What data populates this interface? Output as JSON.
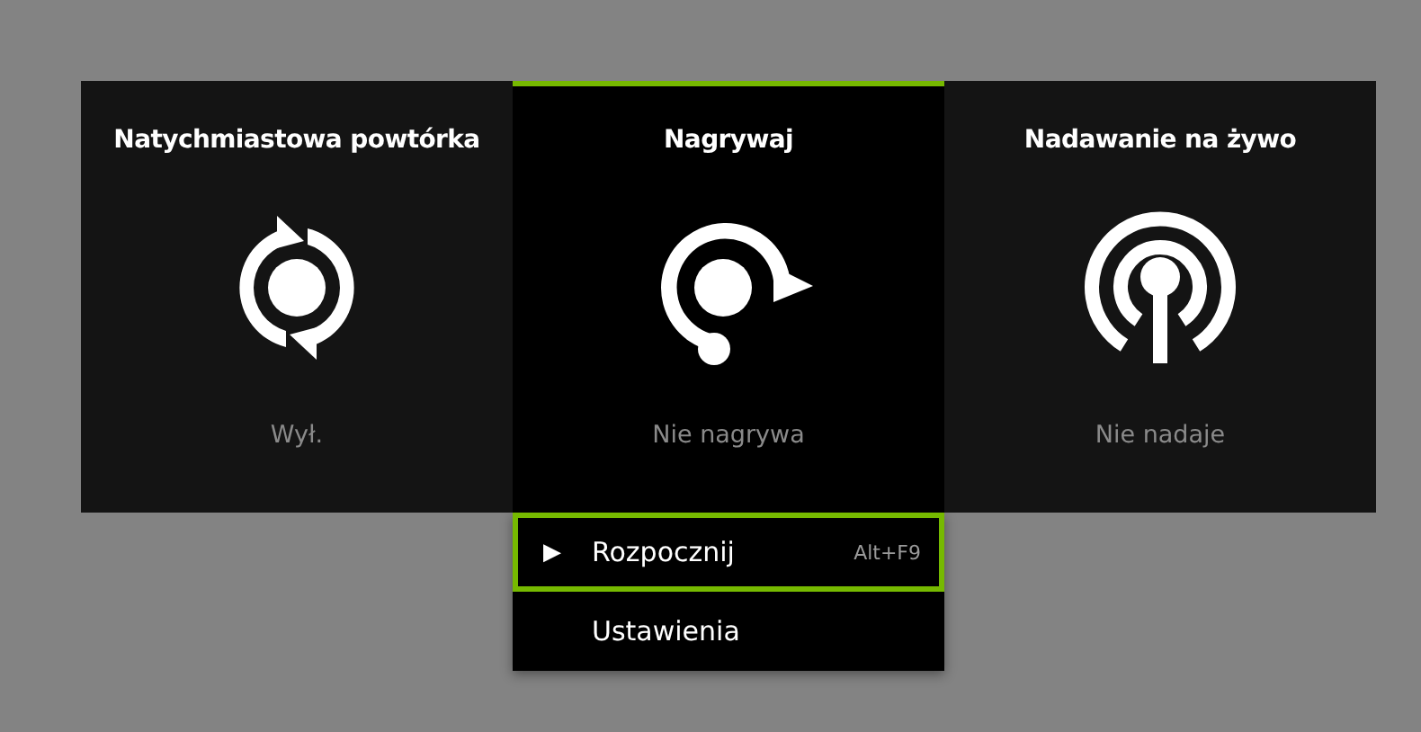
{
  "tiles": [
    {
      "kind": "replay",
      "title": "Natychmiastowa powtórka",
      "status": "Wył.",
      "selected": false
    },
    {
      "kind": "record",
      "title": "Nagrywaj",
      "status": "Nie nagrywa",
      "selected": true
    },
    {
      "kind": "broadcast",
      "title": "Nadawanie na żywo",
      "status": "Nie nadaje",
      "selected": false
    }
  ],
  "menu": {
    "items": [
      {
        "label": "Rozpocznij",
        "icon": "▶",
        "shortcut": "Alt+F9",
        "selected": true
      },
      {
        "label": "Ustawienia",
        "selected": false
      }
    ]
  }
}
